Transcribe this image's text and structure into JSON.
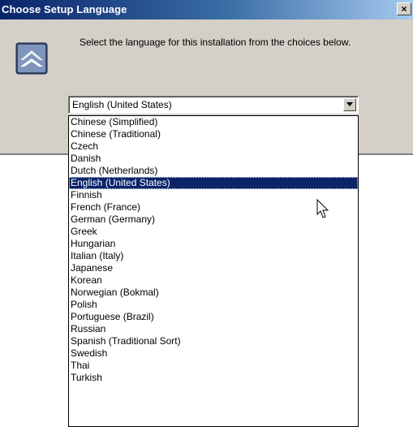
{
  "window": {
    "title": "Choose Setup Language",
    "close_label": "×"
  },
  "dialog": {
    "instruction": "Select the language for this installation from the choices below.",
    "app_icon": "setup-icon"
  },
  "language_select": {
    "selected_value": "English (United States)",
    "options": [
      "Chinese (Simplified)",
      "Chinese (Traditional)",
      "Czech",
      "Danish",
      "Dutch (Netherlands)",
      "English (United States)",
      "Finnish",
      "French (France)",
      "German (Germany)",
      "Greek",
      "Hungarian",
      "Italian (Italy)",
      "Japanese",
      "Korean",
      "Norwegian (Bokmal)",
      "Polish",
      "Portuguese (Brazil)",
      "Russian",
      "Spanish (Traditional Sort)",
      "Swedish",
      "Thai",
      "Turkish"
    ],
    "highlighted_index": 5
  },
  "colors": {
    "title_bar": "#0a246a",
    "dialog_face": "#d4d0c8",
    "selection": "#0a246a"
  }
}
